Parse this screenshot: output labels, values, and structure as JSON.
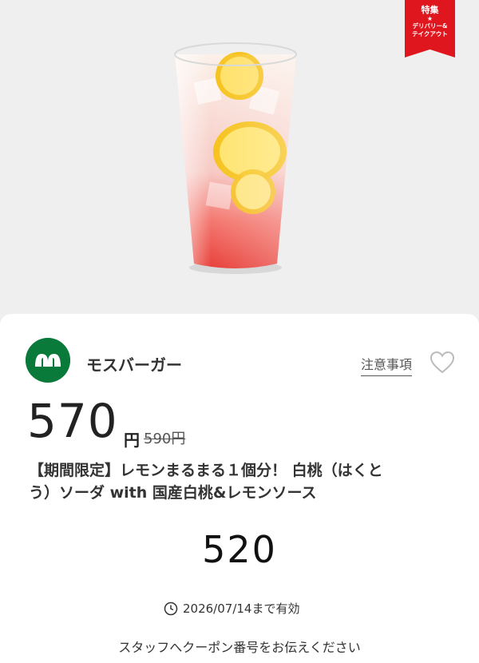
{
  "badge": {
    "line1": "特集",
    "line2": "★",
    "line3": "デリバリー&",
    "line4": "テイクアウト"
  },
  "brand": {
    "name": "モスバーガー"
  },
  "actions": {
    "notice_label": "注意事項"
  },
  "price": {
    "current": "570",
    "unit": "円",
    "original": "590円"
  },
  "product": {
    "title_line1": "【期間限定】レモンまるまる１個分！ 白桃（はくと",
    "title_line2": "う）ソーダ with 国産白桃&レモンソース"
  },
  "coupon": {
    "code": "520",
    "valid_until": "2026/07/14まで有効",
    "instruction": "スタッフへクーポン番号をお伝えください"
  },
  "colors": {
    "accent": "#e0161e",
    "brand": "#0a7a3a"
  }
}
